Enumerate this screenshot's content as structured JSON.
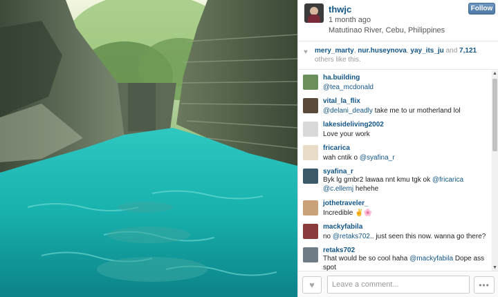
{
  "post": {
    "username": "thwjc",
    "time_ago": "1 month ago",
    "location": "Matutinao River, Cebu, Philippines",
    "follow_label": "Follow"
  },
  "likes": {
    "user1": "mery_marty",
    "sep1": ", ",
    "user2": "nur.huseynova",
    "sep2": ", ",
    "user3": "yay_its_ju",
    "and_text": " and ",
    "count": "7,121",
    "suffix": " others like this."
  },
  "comments": [
    {
      "user": "ha.building",
      "mention": "@tea_mcdonald",
      "text": "",
      "avatar_color": "#6b8e5a"
    },
    {
      "user": "vital_la_flix",
      "mention": "@delani_deadly",
      "text": " take me to ur motherland lol",
      "avatar_color": "#5a4a3a"
    },
    {
      "user": "lakesideliving2002",
      "mention": "",
      "text": "Love your work",
      "avatar_color": "#d9d9d9"
    },
    {
      "user": "fricarica",
      "mention": "",
      "text": "wah cntik o ",
      "mention2": "@syafina_r",
      "avatar_color": "#e8dcc8"
    },
    {
      "user": "syafina_r",
      "mention": "",
      "text": "Byk lg gmbr2 lawaa nnt kmu tgk ok ",
      "mention2": "@fricarica",
      "text2": " ",
      "mention3": "@c.ellemj",
      "text3": " hehehe",
      "avatar_color": "#3a5a6a"
    },
    {
      "user": "jothetraveler_",
      "mention": "",
      "text": "Incredible ✌🌸",
      "avatar_color": "#c9a27a"
    },
    {
      "user": "mackyfabila",
      "mention": "",
      "text": "no ",
      "mention2": "@retaks702",
      "text2": ".. just seen this now. wanna go there?",
      "avatar_color": "#8a3b3b"
    },
    {
      "user": "retaks702",
      "mention": "",
      "text": "That would be so cool haha ",
      "mention2": "@mackyfabila",
      "text2": " Dope ass spot",
      "avatar_color": "#6f7c86"
    }
  ],
  "footer": {
    "comment_placeholder": "Leave a comment...",
    "more_label": "•••"
  },
  "icons": {
    "heart": "♥",
    "scroll_up": "▲",
    "scroll_down": "▼"
  },
  "colors": {
    "link": "#125688",
    "follow_bg": "#5a84b0"
  }
}
